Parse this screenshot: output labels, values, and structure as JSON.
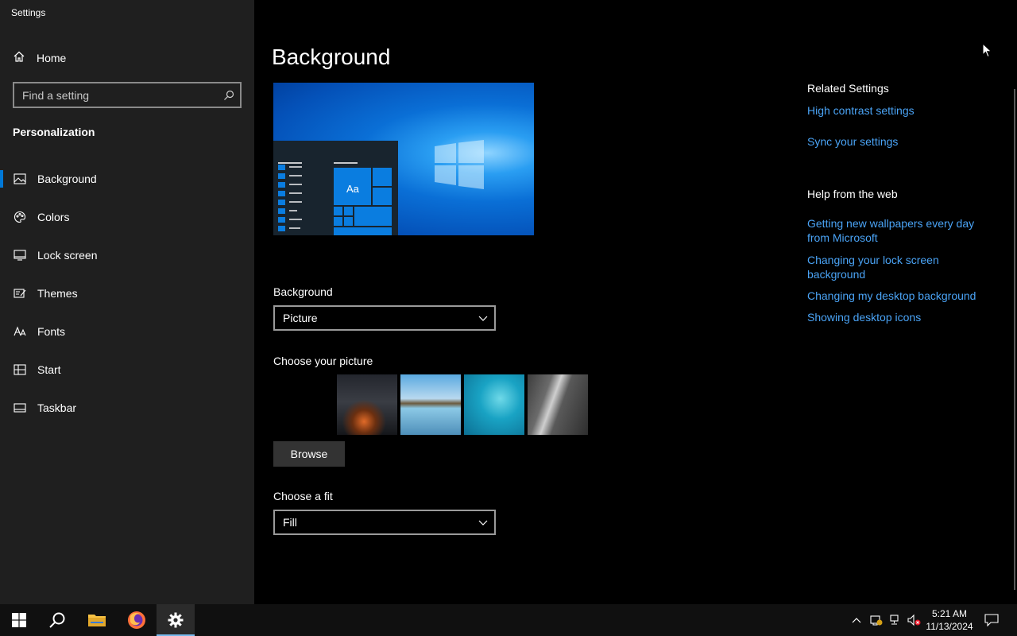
{
  "window": {
    "title": "Settings"
  },
  "sidebar": {
    "home_label": "Home",
    "search_placeholder": "Find a setting",
    "section": "Personalization",
    "items": [
      {
        "label": "Background",
        "icon": "image-icon",
        "active": true
      },
      {
        "label": "Colors",
        "icon": "palette-icon"
      },
      {
        "label": "Lock screen",
        "icon": "lock-screen-icon"
      },
      {
        "label": "Themes",
        "icon": "themes-icon"
      },
      {
        "label": "Fonts",
        "icon": "fonts-icon"
      },
      {
        "label": "Start",
        "icon": "start-icon"
      },
      {
        "label": "Taskbar",
        "icon": "taskbar-icon"
      }
    ]
  },
  "main": {
    "title": "Background",
    "preview": {
      "sample_text": "Aa"
    },
    "background_label": "Background",
    "background_value": "Picture",
    "choose_picture_label": "Choose your picture",
    "browse_label": "Browse",
    "fit_label": "Choose a fit",
    "fit_value": "Fill"
  },
  "related": {
    "heading": "Related Settings",
    "links": [
      "High contrast settings",
      "Sync your settings"
    ],
    "help_heading": "Help from the web",
    "help_links": [
      "Getting new wallpapers every day from Microsoft",
      "Changing your lock screen background",
      "Changing my desktop background",
      "Showing desktop icons"
    ]
  },
  "taskbar": {
    "time": "5:21 AM",
    "date": "11/13/2024"
  },
  "colors": {
    "accent": "#0078d7",
    "link": "#4aa3f5",
    "close": "#e81123",
    "sidebar": "#1f1f1f"
  }
}
